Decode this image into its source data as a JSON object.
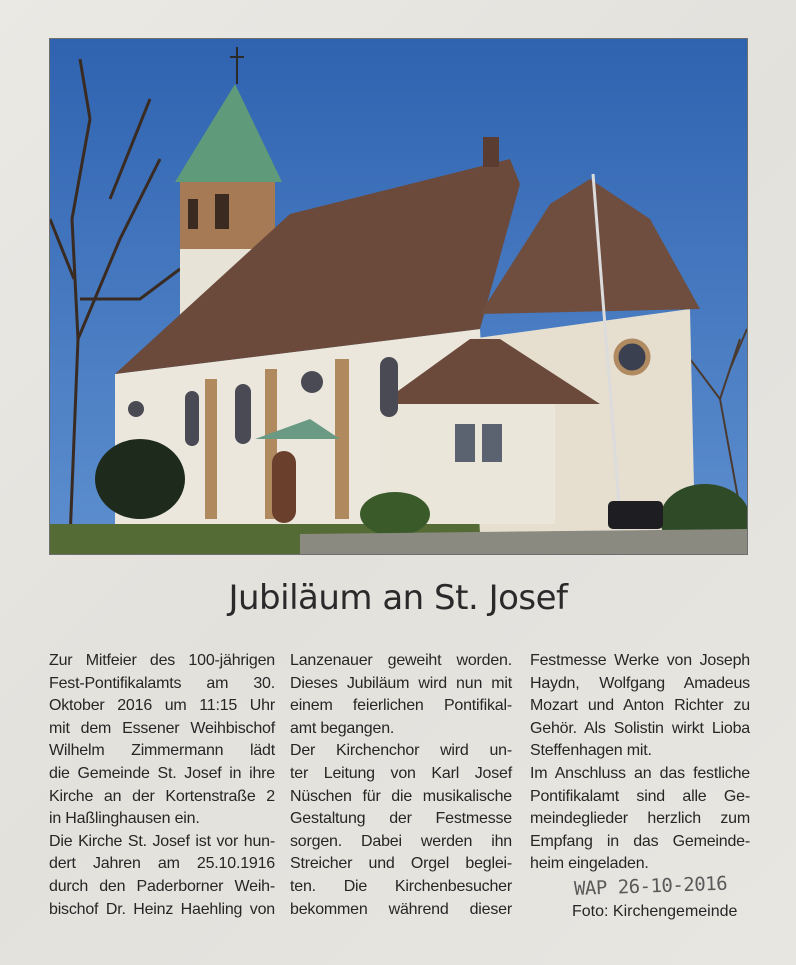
{
  "article": {
    "photo": {
      "subject": "church-photo",
      "colors": {
        "sky": "#3b6fb8",
        "roof": "#6b4a3c",
        "spire": "#5f9a7a",
        "wall": "#ece7dc",
        "lawn": "#4f6a35"
      }
    },
    "headline": "Jubiläum an St. Josef",
    "columns": [
      {
        "lines": [
          "Zur Mitfeier des 100-jährigen",
          "Fest-Pontifikalamts am 30.",
          "Oktober 2016 um 11:15 Uhr",
          "mit dem Essener Weihbischof",
          "Wilhelm Zimmermann lädt",
          "die Gemeinde St. Josef in ihre",
          "Kirche an der Kortenstraße 2",
          "in Haßlinghausen ein.",
          "Die Kirche St. Josef ist vor hun-",
          "dert Jahren am 25.10.1916",
          "durch den Paderborner Weih-",
          "bischof Dr. Heinz Haehling von"
        ]
      },
      {
        "lines": [
          "Lanzenauer geweiht worden.",
          "Dieses Jubiläum wird nun mit",
          "einem feierlichen Pontifikal-",
          "amt begangen.",
          "Der Kirchenchor wird un-",
          "ter Leitung von Karl Josef",
          "Nüschen für die musikalische",
          "Gestaltung der Festmesse",
          "sorgen. Dabei werden ihn",
          "Streicher und Orgel beglei-",
          "ten. Die Kirchenbesucher",
          "bekommen während dieser"
        ]
      },
      {
        "lines": [
          "Festmesse Werke von Joseph",
          "Haydn, Wolfgang Amadeus",
          "Mozart und Anton Richter zu",
          "Gehör. Als Solistin wirkt Lioba",
          "Steffenhagen mit.",
          "Im Anschluss an das festliche",
          "Pontifikalamt sind alle Ge-",
          "meindeglieder herzlich zum",
          "Empfang in das Gemeinde-",
          "heim eingeladen."
        ]
      }
    ],
    "handwritten_note": "WAP 26-10-2016",
    "photo_credit": "Foto: Kirchengemeinde"
  }
}
